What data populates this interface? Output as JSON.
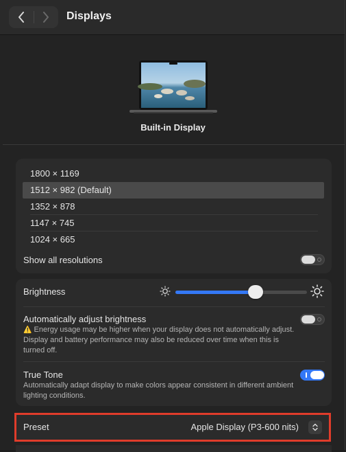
{
  "window": {
    "title": "Displays"
  },
  "nav": {
    "back_icon": "chevron-left-icon",
    "forward_icon": "chevron-right-icon"
  },
  "display": {
    "name": "Built-in Display"
  },
  "resolutions": {
    "items": [
      "1800 × 1169",
      "1512 × 982 (Default)",
      "1352 × 878",
      "1147 × 745",
      "1024 × 665"
    ],
    "selected_index": 1,
    "show_all_label": "Show all resolutions",
    "show_all_enabled": false
  },
  "brightness": {
    "label": "Brightness",
    "level": 0.61,
    "auto_label": "Automatically adjust brightness",
    "auto_enabled": false,
    "auto_warning_icon": "⚠️",
    "auto_desc": "Energy usage may be higher when your display does not automatically adjust. Display and battery performance may also be reduced over time when this is turned off.",
    "true_tone_label": "True Tone",
    "true_tone_enabled": true,
    "true_tone_desc": "Automatically adapt display to make colors appear consistent in different ambient lighting conditions."
  },
  "preset": {
    "label": "Preset",
    "value": "Apple Display (P3-600 nits)"
  },
  "colors": {
    "accent": "#3478f6",
    "highlight_border": "#e03c2b",
    "background": "#232323",
    "card": "#2b2b2b"
  }
}
